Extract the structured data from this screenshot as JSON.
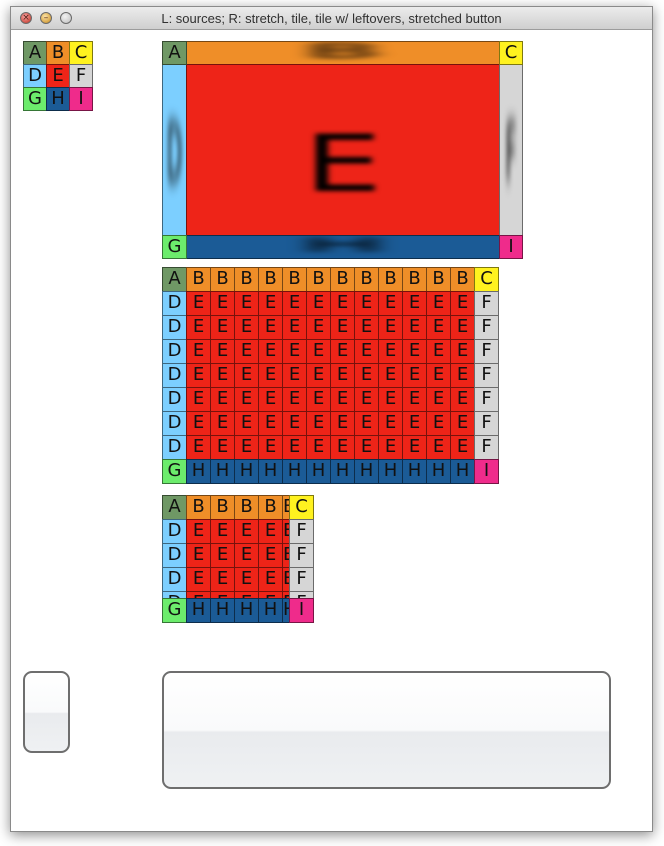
{
  "window": {
    "title": "L: sources; R: stretch, tile, tile w/ leftovers, stretched button",
    "controls": [
      "close-icon",
      "minimize-icon",
      "zoom-icon"
    ]
  },
  "tiles": {
    "a": "A",
    "b": "B",
    "c": "C",
    "d": "D",
    "e": "E",
    "f": "F",
    "g": "G",
    "h": "H",
    "i": "I"
  },
  "colors": {
    "a": "#6f9865",
    "b": "#ef8e28",
    "c": "#fff21f",
    "d": "#7ccfff",
    "e": "#ee2418",
    "f": "#d6d6d6",
    "g": "#6cec6c",
    "h": "#1b5b96",
    "i": "#ef2b8b"
  },
  "tiled_grid": {
    "columns": 14,
    "rows": 9
  },
  "leftover_grid": {
    "columns": 7,
    "rows": 6
  }
}
